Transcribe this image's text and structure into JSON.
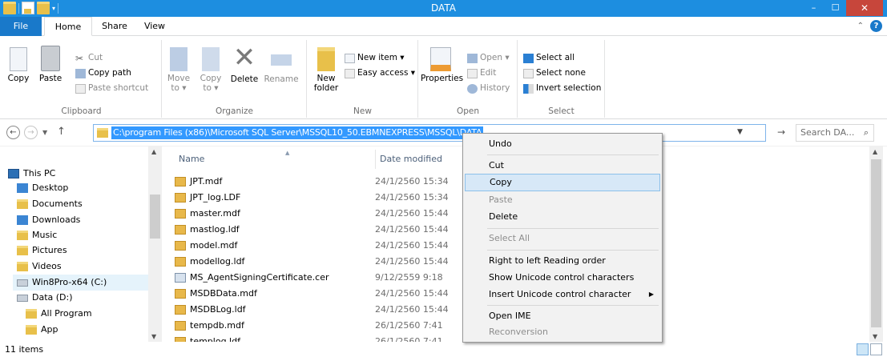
{
  "window": {
    "title": "DATA"
  },
  "window_controls": {
    "minimize": "–",
    "maximize": "☐",
    "close": "✕"
  },
  "tabs": {
    "file": "File",
    "home": "Home",
    "share": "Share",
    "view": "View"
  },
  "ribbon": {
    "clipboard": {
      "label": "Clipboard",
      "copy": "Copy",
      "paste": "Paste",
      "cut": "Cut",
      "copy_path": "Copy path",
      "paste_shortcut": "Paste shortcut"
    },
    "organize": {
      "label": "Organize",
      "move_to": "Move to ▾",
      "copy_to": "Copy to ▾",
      "delete": "Delete",
      "rename": "Rename"
    },
    "new": {
      "label": "New",
      "new_folder": "New folder",
      "new_item": "New item ▾",
      "easy_access": "Easy access ▾"
    },
    "open": {
      "label": "Open",
      "properties": "Properties",
      "open": "Open ▾",
      "edit": "Edit",
      "history": "History"
    },
    "select": {
      "label": "Select",
      "select_all": "Select all",
      "select_none": "Select none",
      "invert_selection": "Invert selection"
    }
  },
  "address": {
    "path": "C:\\program Files (x86)\\Microsoft SQL Server\\MSSQL10_50.EBMNEXPRESS\\MSSQL\\DATA",
    "search_placeholder": "Search DA..."
  },
  "nav": [
    {
      "label": "This PC",
      "icon": "pc-icon"
    },
    {
      "label": "Desktop",
      "icon": "desktop-folder-icon"
    },
    {
      "label": "Documents",
      "icon": "documents-folder-icon"
    },
    {
      "label": "Downloads",
      "icon": "downloads-folder-icon"
    },
    {
      "label": "Music",
      "icon": "music-folder-icon"
    },
    {
      "label": "Pictures",
      "icon": "pictures-folder-icon"
    },
    {
      "label": "Videos",
      "icon": "videos-folder-icon"
    },
    {
      "label": "Win8Pro-x64 (C:)",
      "icon": "windows-drive-icon"
    },
    {
      "label": "Data (D:)",
      "icon": "drive-icon"
    },
    {
      "label": "All Program",
      "icon": "folder-icon"
    },
    {
      "label": "App",
      "icon": "folder-icon"
    }
  ],
  "columns": {
    "name": "Name",
    "date_modified": "Date modified"
  },
  "files": [
    {
      "name": "JPT.mdf",
      "date": "24/1/2560 15:34",
      "icon": "database-file-icon"
    },
    {
      "name": "JPT_log.LDF",
      "date": "24/1/2560 15:34",
      "icon": "database-file-icon"
    },
    {
      "name": "master.mdf",
      "date": "24/1/2560 15:44",
      "icon": "database-file-icon"
    },
    {
      "name": "mastlog.ldf",
      "date": "24/1/2560 15:44",
      "icon": "database-file-icon"
    },
    {
      "name": "model.mdf",
      "date": "24/1/2560 15:44",
      "icon": "database-file-icon"
    },
    {
      "name": "modellog.ldf",
      "date": "24/1/2560 15:44",
      "icon": "database-file-icon"
    },
    {
      "name": "MS_AgentSigningCertificate.cer",
      "date": "9/12/2559 9:18",
      "icon": "certificate-file-icon"
    },
    {
      "name": "MSDBData.mdf",
      "date": "24/1/2560 15:44",
      "icon": "database-file-icon"
    },
    {
      "name": "MSDBLog.ldf",
      "date": "24/1/2560 15:44",
      "icon": "database-file-icon"
    },
    {
      "name": "tempdb.mdf",
      "date": "26/1/2560 7:41",
      "icon": "database-file-icon"
    },
    {
      "name": "templog.ldf",
      "date": "26/1/2560 7:41",
      "icon": "database-file-icon"
    }
  ],
  "status": {
    "items": "11 items"
  },
  "context_menu": {
    "undo": "Undo",
    "cut": "Cut",
    "copy": "Copy",
    "paste": "Paste",
    "delete": "Delete",
    "select_all": "Select All",
    "rtl": "Right to left Reading order",
    "show_unicode": "Show Unicode control characters",
    "insert_unicode": "Insert Unicode control character",
    "open_ime": "Open IME",
    "reconversion": "Reconversion"
  },
  "colors": {
    "titlebar": "#1d8ee0",
    "file_tab": "#1979ca",
    "selection": "#3399ff",
    "close": "#c7463b"
  }
}
